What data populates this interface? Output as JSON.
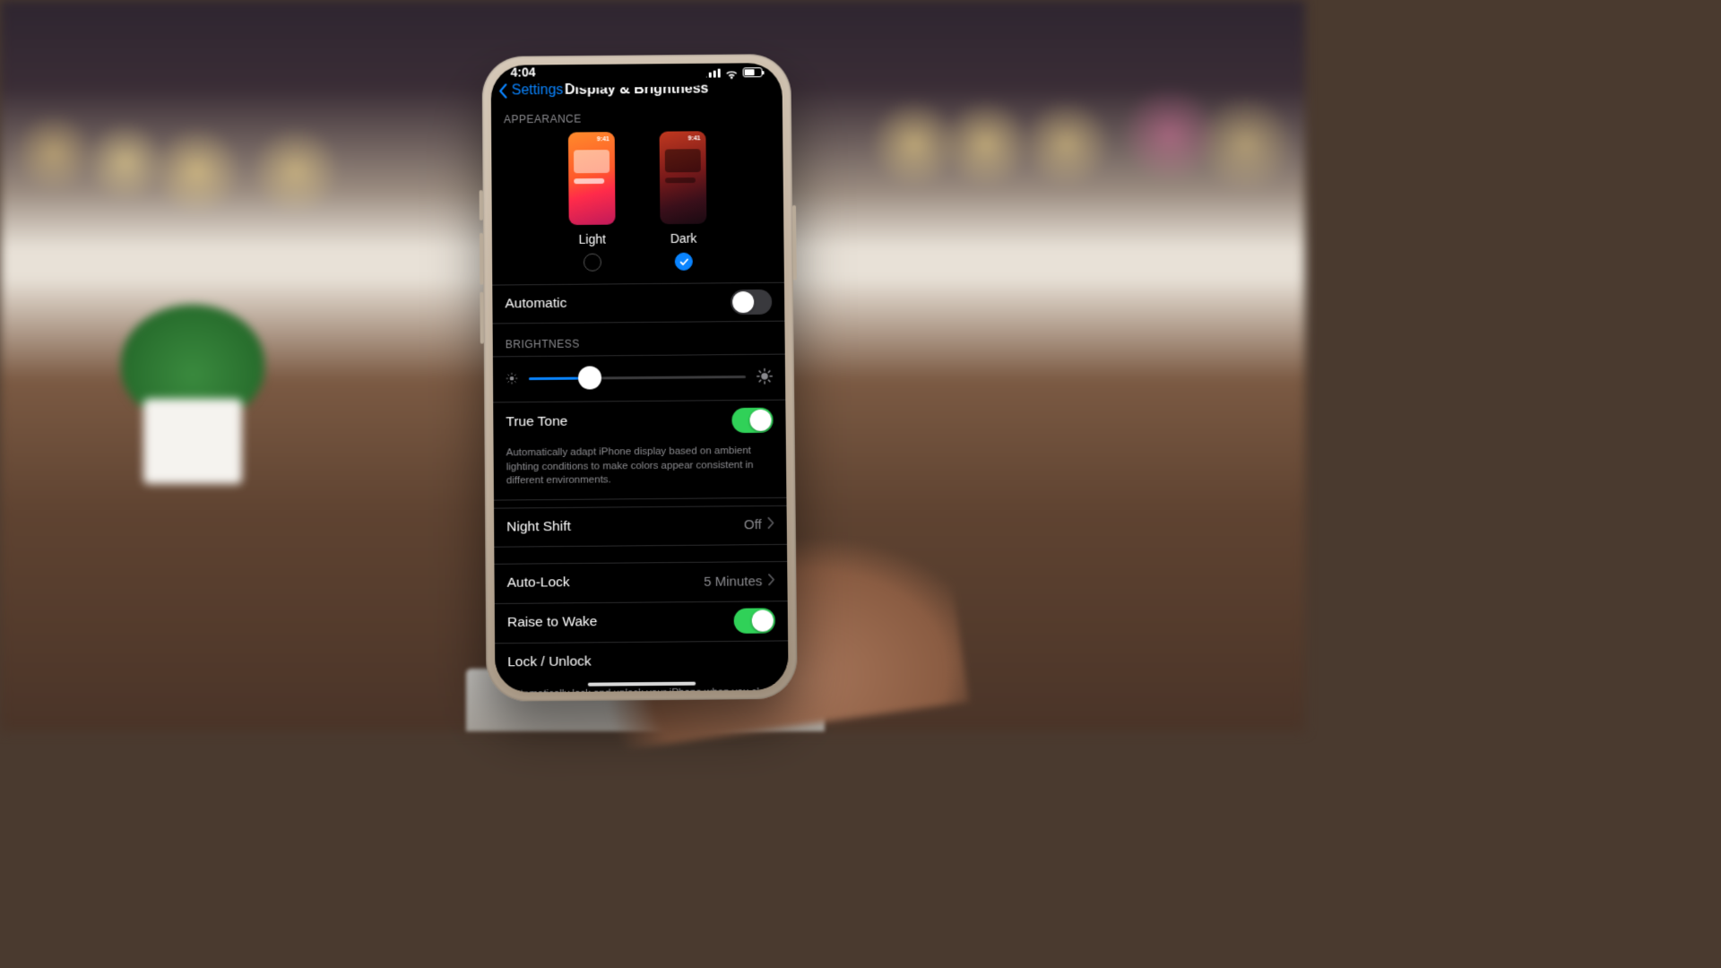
{
  "status": {
    "time": "4:04"
  },
  "nav": {
    "back_label": "Settings",
    "title": "Display & Brightness"
  },
  "sections": {
    "appearance": {
      "header": "APPEARANCE",
      "preview_time": "9:41",
      "options": {
        "light": {
          "label": "Light",
          "selected": false
        },
        "dark": {
          "label": "Dark",
          "selected": true
        }
      },
      "automatic_label": "Automatic",
      "automatic_on": false
    },
    "brightness": {
      "header": "BRIGHTNESS",
      "slider_percent": 28,
      "true_tone_label": "True Tone",
      "true_tone_on": true,
      "true_tone_desc": "Automatically adapt iPhone display based on ambient lighting conditions to make colors appear consistent in different environments."
    },
    "night_shift": {
      "label": "Night Shift",
      "value": "Off"
    },
    "auto_lock": {
      "label": "Auto-Lock",
      "value": "5 Minutes"
    },
    "raise_to_wake": {
      "label": "Raise to Wake",
      "on": true
    },
    "lock_unlock": {
      "label": "Lock / Unlock",
      "desc": "Automatically lock and unlock your iPhone when you close and open the iPhone cover."
    }
  }
}
